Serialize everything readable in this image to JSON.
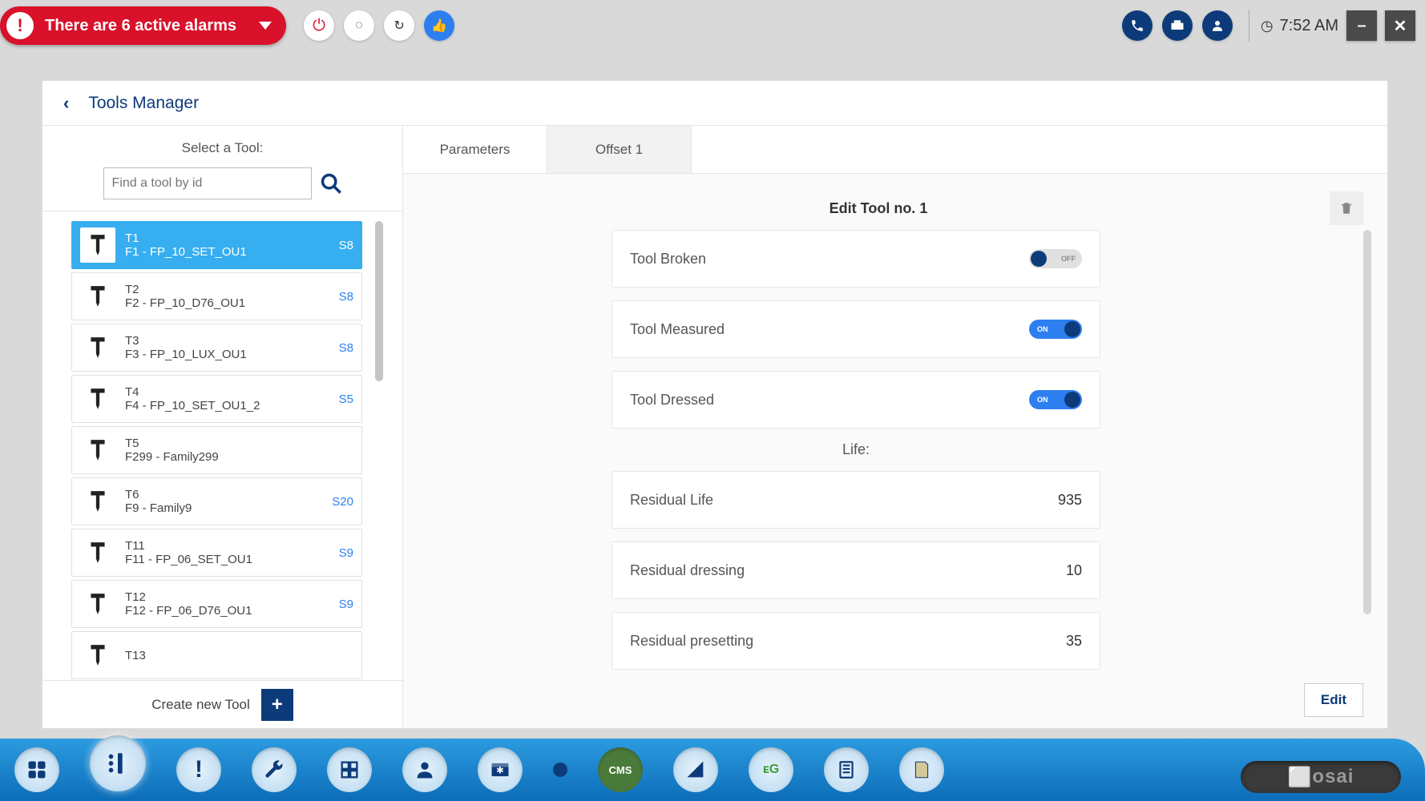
{
  "topbar": {
    "alarm_text": "There are 6 active alarms",
    "time": "7:52 AM"
  },
  "header": {
    "title": "Tools Manager"
  },
  "sidebar": {
    "select_label": "Select a Tool:",
    "search_placeholder": "Find a tool by id",
    "create_label": "Create new Tool",
    "tools": [
      {
        "id": "T1",
        "family": "F1 - FP_10_SET_OU1",
        "badge": "S8",
        "selected": true
      },
      {
        "id": "T2",
        "family": "F2 - FP_10_D76_OU1",
        "badge": "S8",
        "selected": false
      },
      {
        "id": "T3",
        "family": "F3 - FP_10_LUX_OU1",
        "badge": "S8",
        "selected": false
      },
      {
        "id": "T4",
        "family": "F4 - FP_10_SET_OU1_2",
        "badge": "S5",
        "selected": false
      },
      {
        "id": "T5",
        "family": "F299 - Family299",
        "badge": "",
        "selected": false
      },
      {
        "id": "T6",
        "family": "F9 - Family9",
        "badge": "S20",
        "selected": false
      },
      {
        "id": "T11",
        "family": "F11 - FP_06_SET_OU1",
        "badge": "S9",
        "selected": false
      },
      {
        "id": "T12",
        "family": "F12 - FP_06_D76_OU1",
        "badge": "S9",
        "selected": false
      },
      {
        "id": "T13",
        "family": "",
        "badge": "",
        "selected": false
      }
    ]
  },
  "tabs": {
    "parameters": "Parameters",
    "offset1": "Offset 1"
  },
  "editor": {
    "title": "Edit Tool no. 1",
    "tool_broken": {
      "label": "Tool Broken",
      "state": "OFF"
    },
    "tool_measured": {
      "label": "Tool Measured",
      "state": "ON"
    },
    "tool_dressed": {
      "label": "Tool Dressed",
      "state": "ON"
    },
    "life_label": "Life:",
    "residual_life": {
      "label": "Residual Life",
      "value": "935"
    },
    "residual_dressing": {
      "label": "Residual dressing",
      "value": "10"
    },
    "residual_presetting": {
      "label": "Residual presetting",
      "value": "35"
    },
    "edit_button": "Edit"
  },
  "brand": "osai"
}
